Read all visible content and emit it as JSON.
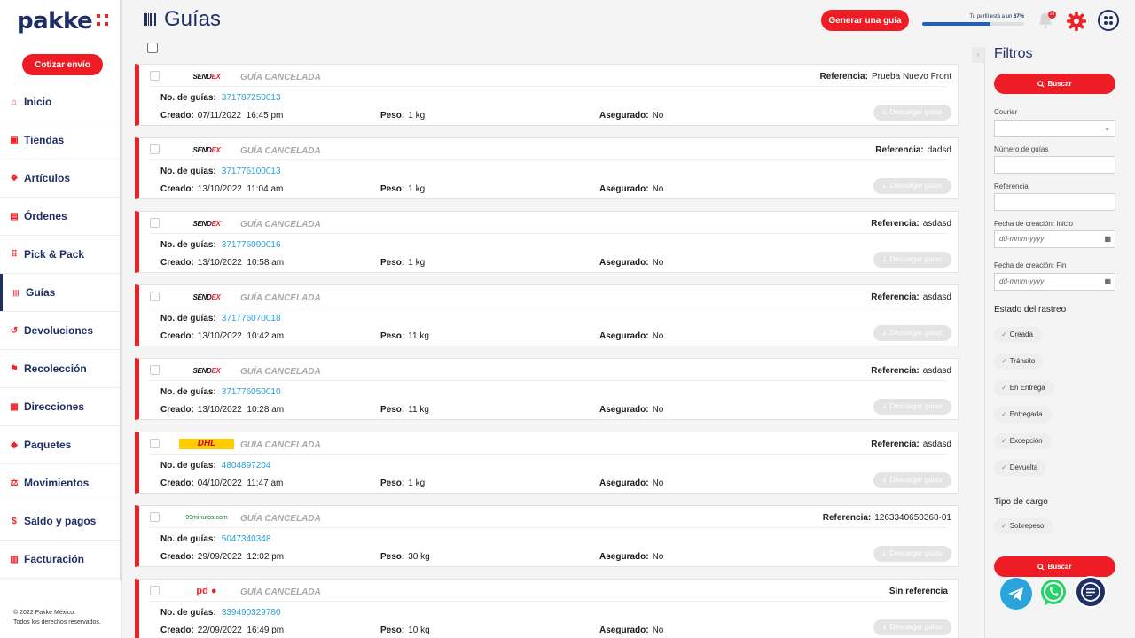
{
  "brand": {
    "name": "pakke",
    "accent": "#ee1c24",
    "navy": "#1f2e64",
    "link": "#2a9fd6"
  },
  "sidebar": {
    "cta_label": "Cotizar envío",
    "items": [
      {
        "label": "Inicio",
        "icon": "home-icon"
      },
      {
        "label": "Tiendas",
        "icon": "store-icon"
      },
      {
        "label": "Artículos",
        "icon": "tag-icon"
      },
      {
        "label": "Órdenes",
        "icon": "document-icon"
      },
      {
        "label": "Pick & Pack",
        "icon": "grid-icon"
      },
      {
        "label": "Guías",
        "icon": "barcode-icon"
      },
      {
        "label": "Devoluciones",
        "icon": "return-icon"
      },
      {
        "label": "Recolección",
        "icon": "pickup-icon"
      },
      {
        "label": "Direcciones",
        "icon": "address-icon"
      },
      {
        "label": "Paquetes",
        "icon": "box-icon"
      },
      {
        "label": "Movimientos",
        "icon": "movement-icon"
      },
      {
        "label": "Saldo y pagos",
        "icon": "money-icon"
      },
      {
        "label": "Facturación",
        "icon": "invoice-icon"
      }
    ],
    "footer_line1": "© 2022 Pakke México.",
    "footer_line2": "Todos los derechos reservados."
  },
  "header": {
    "title": "Guías",
    "generate_label": "Generar una guía",
    "profile_text": "Tu perfil está a un",
    "profile_pct_label": "67%",
    "profile_progress": 0.67,
    "notification_count": "26"
  },
  "labels": {
    "status": "GUÍA CANCELADA",
    "ref": "Referencia:",
    "no_guias": "No. de guías:",
    "creado": "Creado:",
    "peso": "Peso:",
    "asegurado": "Asegurado:",
    "download": "Descargar guías"
  },
  "guides": [
    {
      "courier": "sendex",
      "ref_label": "Referencia:",
      "ref": "Prueba Nuevo Front",
      "num": "371787250013",
      "created": "07/11/2022  16:45 pm",
      "weight": "1 kg",
      "insured": "No"
    },
    {
      "courier": "sendex",
      "ref_label": "Referencia:",
      "ref": "dadsd",
      "num": "371776100013",
      "created": "13/10/2022  11:04 am",
      "weight": "1 kg",
      "insured": "No"
    },
    {
      "courier": "sendex",
      "ref_label": "Referencia:",
      "ref": "asdasd",
      "num": "371776090016",
      "created": "13/10/2022  10:58 am",
      "weight": "1 kg",
      "insured": "No"
    },
    {
      "courier": "sendex",
      "ref_label": "Referencia:",
      "ref": "asdasd",
      "num": "371776070018",
      "created": "13/10/2022  10:42 am",
      "weight": "11 kg",
      "insured": "No"
    },
    {
      "courier": "sendex",
      "ref_label": "Referencia:",
      "ref": "asdasd",
      "num": "371776050010",
      "created": "13/10/2022  10:28 am",
      "weight": "11 kg",
      "insured": "No"
    },
    {
      "courier": "dhl",
      "ref_label": "Referencia:",
      "ref": "asdasd",
      "num": "4804897204",
      "created": "04/10/2022  11:47 am",
      "weight": "1 kg",
      "insured": "No"
    },
    {
      "courier": "99minutos",
      "ref_label": "Referencia:",
      "ref": "1263340650368-01",
      "num": "5047340348",
      "created": "29/09/2022  12:02 pm",
      "weight": "30 kg",
      "insured": "No"
    },
    {
      "courier": "pd",
      "ref_label": "Sin referencia",
      "ref": "",
      "num": "339490329780",
      "created": "22/09/2022  16:49 pm",
      "weight": "10 kg",
      "insured": "No"
    }
  ],
  "courier_logos": {
    "sendex_a": "SEND",
    "sendex_b": "EX",
    "dhl": "DHL",
    "min99": "99minutos.com",
    "pd_a": "pd",
    "pd_b": "●"
  },
  "filters": {
    "title": "Filtros",
    "search_label": "Buscar",
    "courier_label": "Courier",
    "num_label": "Número de guías",
    "ref_label": "Referencia",
    "date_start_label": "Fecha de creación: Inicio",
    "date_end_label": "Fecha de creación: Fin",
    "date_placeholder": "dd-mmm-yyyy",
    "tracking_title": "Estado del rastreo",
    "tracking": [
      "Creada",
      "Tránsito",
      "En Entrega",
      "Entregada",
      "Excepción",
      "Devuelta"
    ],
    "cargo_title": "Tipo de cargo",
    "cargo": [
      "Sobrepeso"
    ]
  }
}
